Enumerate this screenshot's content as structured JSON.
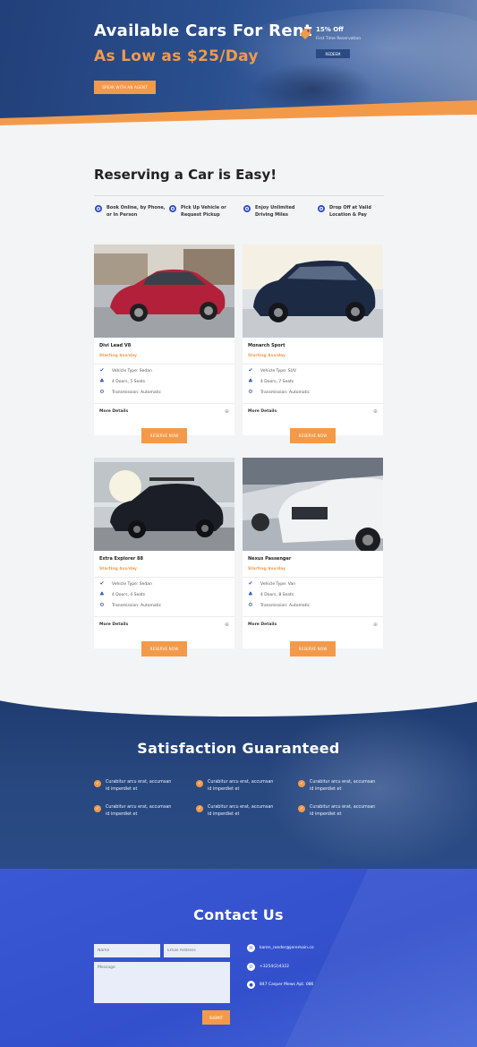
{
  "hero": {
    "title": "Available Cars For Rent",
    "subtitle": "As Low as $25/Day",
    "cta_label": "SPEAK WITH AN AGENT",
    "offer_title": "15% Off",
    "offer_subtitle": "First Time Reservation",
    "redeem_label": "REDEEM"
  },
  "reserving": {
    "title": "Reserving a Car is Easy!",
    "steps": [
      {
        "line1": "Book Online, by Phone,",
        "line2": "or In Person"
      },
      {
        "line1": "Pick Up Vehicle or",
        "line2": "Request Pickup"
      },
      {
        "line1": "Enjoy Unlimited",
        "line2": "Driving Miles"
      },
      {
        "line1": "Drop Off at Valid",
        "line2": "Location & Pay"
      }
    ]
  },
  "cars": [
    {
      "name": "Divi Lead V8",
      "price": "Starting $xx/day",
      "type": "Vehicle Type: Sedan",
      "doors": "4 Doors, 5 Seats",
      "transmission": "Transmission: Automatic",
      "more": "More Details",
      "reserve": "RESERVE NOW",
      "color": "#b3203a"
    },
    {
      "name": "Monarch Sport",
      "price": "Starting $xx/day",
      "type": "Vehicle Type: SUV",
      "doors": "4 Doors, 7 Seats",
      "transmission": "Transmission: Automatic",
      "more": "More Details",
      "reserve": "RESERVE NOW",
      "color": "#1d2a44"
    },
    {
      "name": "Extra Explorer 88",
      "price": "Starting $xx/day",
      "type": "Vehicle Type: Sedan",
      "doors": "4 Doors, 4 Seats",
      "transmission": "Transmission: Automatic",
      "more": "More Details",
      "reserve": "RESERVE NOW",
      "color": "#1b1e26"
    },
    {
      "name": "Nexus Passenger",
      "price": "Starting $xx/day",
      "type": "Vehicle Type: Van",
      "doors": "4 Doors, 8 Seats",
      "transmission": "Transmission: Automatic",
      "more": "More Details",
      "reserve": "RESERVE NOW",
      "color": "#e8eaee"
    }
  ],
  "satisfaction": {
    "title": "Satisfaction Guaranteed",
    "items": [
      {
        "line1": "Curabitur arcu erat, accumsan",
        "line2": "id imperdiet et"
      },
      {
        "line1": "Curabitur arcu erat, accumsan",
        "line2": "id imperdiet et"
      },
      {
        "line1": "Curabitur arcu erat, accumsan",
        "line2": "id imperdiet et"
      },
      {
        "line1": "Curabitur arcu erat, accumsan",
        "line2": "id imperdiet et"
      },
      {
        "line1": "Curabitur arcu erat, accumsan",
        "line2": "id imperdiet et"
      },
      {
        "line1": "Curabitur arcu erat, accumsan",
        "line2": "id imperdiet et"
      }
    ]
  },
  "contact": {
    "title": "Contact Us",
    "name_placeholder": "Name",
    "email_placeholder": "Email Address",
    "message_placeholder": "Message",
    "submit_label": "SUBMIT",
    "email": "karen_roeder@jeremain.co",
    "phone": "+3254(2)4322",
    "address": "847 Casper Mews Apt. 086"
  },
  "colors": {
    "accent": "#f39a4a",
    "brand_blue": "#3050c8",
    "navy": "#22407a"
  }
}
